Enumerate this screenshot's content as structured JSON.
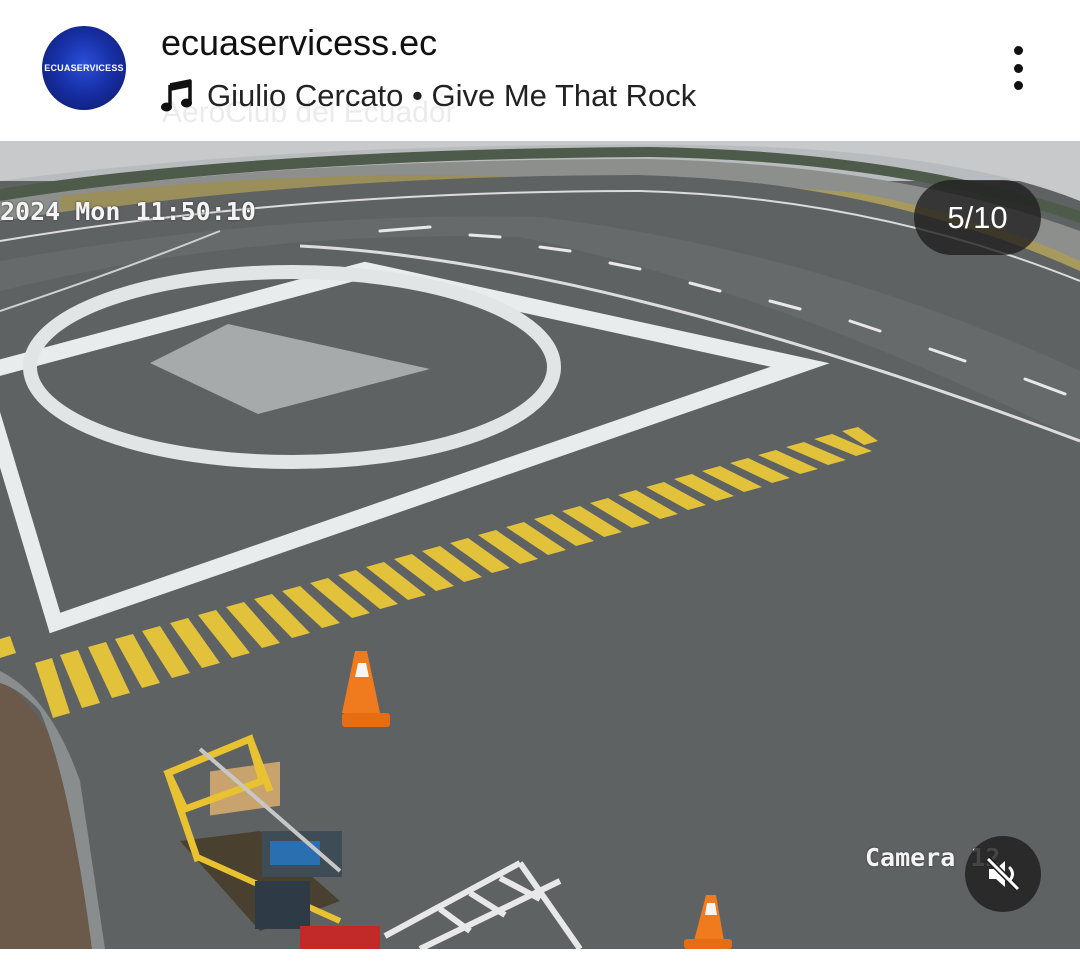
{
  "post": {
    "username": "ecuaservicess.ec",
    "avatar_text": "ECUASERVICESS",
    "music": {
      "icon": "music-note-icon",
      "label": "Giulio Cercato • Give Me That Rock"
    },
    "location_ghost": "AeroClub del Ecuador",
    "more_icon": "more-vertical-icon"
  },
  "media": {
    "counter": "5/10",
    "timestamp": "2024 Mon 11:50:10",
    "camera_label": "Camera 12",
    "mute_icon": "speaker-muted-icon"
  },
  "colors": {
    "tarmac": "#5f6263",
    "marking_white": "#e9ecec",
    "marking_yellow": "#e2c23a",
    "grass": "#a89a5c",
    "cone": "#f07a1e",
    "badge_bg": "#1e1e1e"
  }
}
